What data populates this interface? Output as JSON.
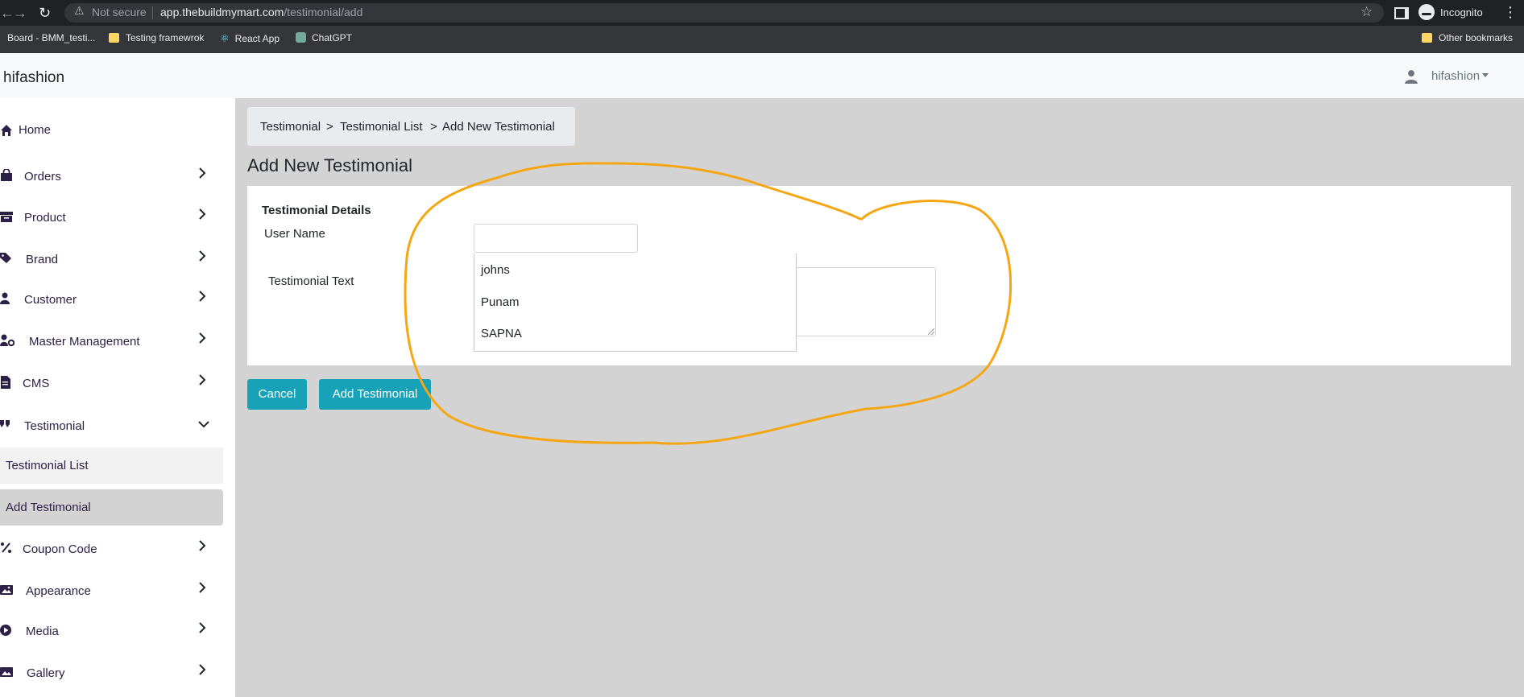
{
  "browser": {
    "security_label": "Not secure",
    "url_host": "app.thebuildmymart.com",
    "url_path": "/testimonial/add",
    "profile_label": "Incognito",
    "bookmarks": [
      "Board - BMM_testi...",
      "Testing framewrok",
      "React App",
      "ChatGPT"
    ],
    "other_bookmarks": "Other bookmarks"
  },
  "header": {
    "brand": "hifashion",
    "user": "hifashion"
  },
  "sidebar": {
    "items": [
      {
        "label": "Home",
        "icon": "home-icon"
      },
      {
        "label": "Orders",
        "icon": "shopping-bag-icon"
      },
      {
        "label": "Product",
        "icon": "box-icon"
      },
      {
        "label": "Brand",
        "icon": "tags-icon"
      },
      {
        "label": "Customer",
        "icon": "user-icon"
      },
      {
        "label": "Master Management",
        "icon": "user-cog-icon"
      },
      {
        "label": "CMS",
        "icon": "file-icon"
      },
      {
        "label": "Testimonial",
        "icon": "quote-icon"
      },
      {
        "label": "Coupon Code",
        "icon": "percent-icon"
      },
      {
        "label": "Appearance",
        "icon": "image-icon"
      },
      {
        "label": "Media",
        "icon": "play-circle-icon"
      },
      {
        "label": "Gallery",
        "icon": "images-icon"
      }
    ],
    "testimonial_sub": [
      "Testimonial List",
      "Add Testimonial"
    ]
  },
  "breadcrumb": {
    "items": [
      "Testimonial",
      "Testimonial List",
      "Add New Testimonial"
    ],
    "separator": ">"
  },
  "page": {
    "title": "Add New Testimonial",
    "card_title": "Testimonial Details",
    "user_name_label": "User Name",
    "user_name_value": "",
    "testimonial_text_label": "Testimonial Text",
    "testimonial_text_value": "",
    "suggestions": [
      "johns",
      "Punam",
      "SAPNA"
    ]
  },
  "buttons": {
    "cancel": "Cancel",
    "add": "Add Testimonial"
  },
  "colors": {
    "accent": "#17a2b8",
    "annotation": "#f5a614",
    "sidebar_text": "#2c2046"
  }
}
